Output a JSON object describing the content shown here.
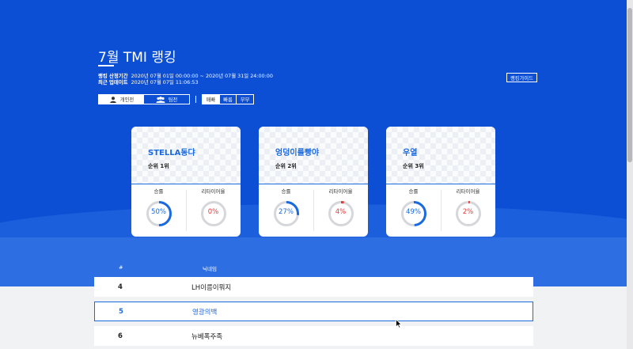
{
  "header": {
    "title": "7월 TMI 랭킹",
    "period_label": "랭킹 산정기간",
    "period_value": "2020년 07월 01일 00:00:00 ~ 2020년 07월 31일 24:00:00",
    "update_label": "최근 업데이트",
    "update_value": "2020년 07월 07일 11:06:53",
    "guide_button": "랭킹가이드"
  },
  "mode_tabs": [
    {
      "label": "개인전",
      "icon": "person-icon",
      "active": true
    },
    {
      "label": "팀전",
      "icon": "group-icon",
      "active": false
    }
  ],
  "speed_tabs": [
    {
      "label": "매빠",
      "active": true
    },
    {
      "label": "빠름",
      "active": false
    },
    {
      "label": "무부",
      "active": false
    }
  ],
  "top_cards": [
    {
      "name": "STELLA동댜",
      "rank": "순위 1위",
      "win_label": "승률",
      "win_rate": "50%",
      "win_fraction": 0.5,
      "retire_label": "리타이어율",
      "retire_rate": "0%",
      "retire_fraction": 0.0
    },
    {
      "name": "엉덩이를빵야",
      "rank": "순위 2위",
      "win_label": "승률",
      "win_rate": "27%",
      "win_fraction": 0.27,
      "retire_label": "리타이어율",
      "retire_rate": "4%",
      "retire_fraction": 0.04
    },
    {
      "name": "우열",
      "rank": "순위 3위",
      "win_label": "승률",
      "win_rate": "49%",
      "win_fraction": 0.49,
      "retire_label": "리타이어율",
      "retire_rate": "2%",
      "retire_fraction": 0.02
    }
  ],
  "table": {
    "headers": [
      "#",
      "닉네임"
    ],
    "rows": [
      {
        "rank": "4",
        "nickname": "LH이름이뭐지"
      },
      {
        "rank": "5",
        "nickname": "영광의백"
      },
      {
        "rank": "6",
        "nickname": "뉴베폭주족"
      }
    ]
  },
  "colors": {
    "brand_blue": "#0d4fd4",
    "accent_blue": "#1a6ae0",
    "retire_red": "#e23a3a"
  }
}
